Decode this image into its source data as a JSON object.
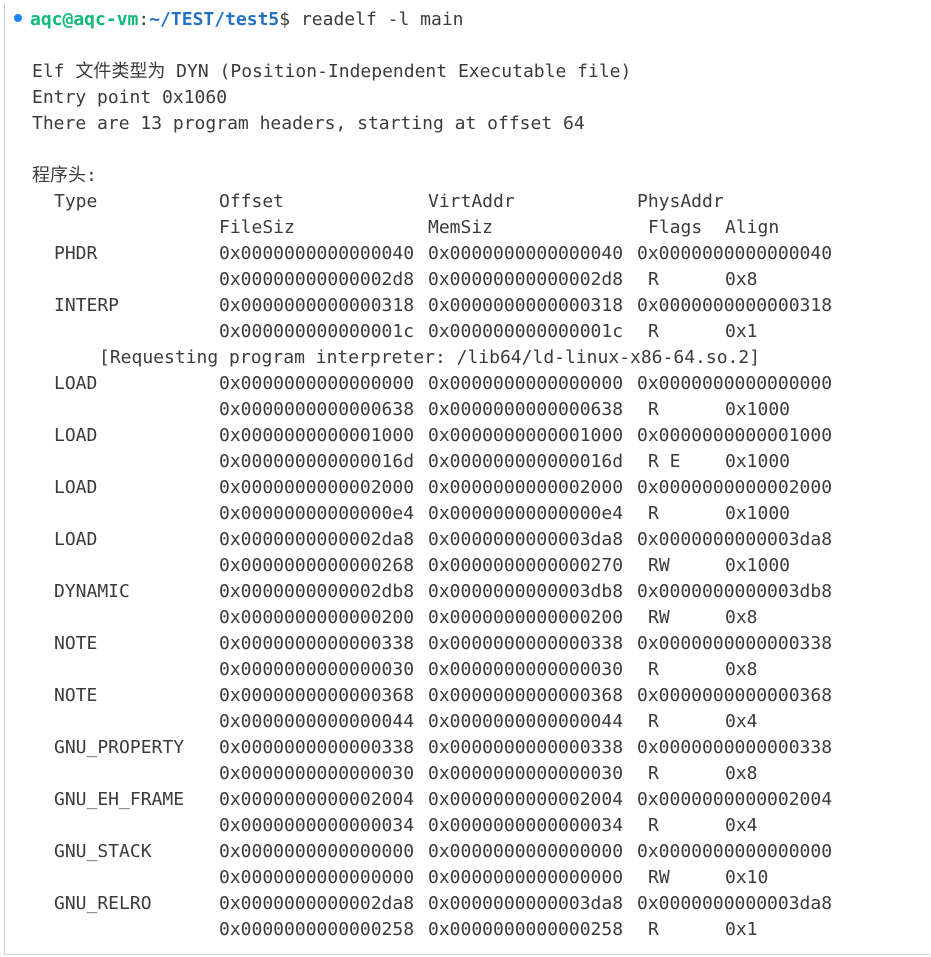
{
  "prompt": {
    "user_host": "aqc@aqc-vm",
    "colon": ":",
    "path": "~/TEST/test5",
    "dollar": "$",
    "command": " readelf -l main"
  },
  "info": {
    "elf_type": "Elf 文件类型为 DYN (Position-Independent Executable file)",
    "entry_point": "Entry point 0x1060",
    "header_count": "There are 13 program headers, starting at offset 64"
  },
  "section_title": "程序头:",
  "columns": {
    "type": "Type",
    "offset": "Offset",
    "virtaddr": "VirtAddr",
    "physaddr": "PhysAddr",
    "filesiz": "FileSiz",
    "memsiz": "MemSiz",
    "flags": "Flags",
    "align": "Align"
  },
  "interp_note": "[Requesting program interpreter: /lib64/ld-linux-x86-64.so.2]",
  "headers": [
    {
      "type": "PHDR",
      "offset": "0x0000000000000040",
      "virtaddr": "0x0000000000000040",
      "physaddr": "0x0000000000000040",
      "filesiz": "0x00000000000002d8",
      "memsiz": "0x00000000000002d8",
      "flags": "R",
      "align": "0x8"
    },
    {
      "type": "INTERP",
      "offset": "0x0000000000000318",
      "virtaddr": "0x0000000000000318",
      "physaddr": "0x0000000000000318",
      "filesiz": "0x000000000000001c",
      "memsiz": "0x000000000000001c",
      "flags": "R",
      "align": "0x1"
    },
    {
      "type": "LOAD",
      "offset": "0x0000000000000000",
      "virtaddr": "0x0000000000000000",
      "physaddr": "0x0000000000000000",
      "filesiz": "0x0000000000000638",
      "memsiz": "0x0000000000000638",
      "flags": "R",
      "align": "0x1000"
    },
    {
      "type": "LOAD",
      "offset": "0x0000000000001000",
      "virtaddr": "0x0000000000001000",
      "physaddr": "0x0000000000001000",
      "filesiz": "0x000000000000016d",
      "memsiz": "0x000000000000016d",
      "flags": "R E",
      "align": "0x1000"
    },
    {
      "type": "LOAD",
      "offset": "0x0000000000002000",
      "virtaddr": "0x0000000000002000",
      "physaddr": "0x0000000000002000",
      "filesiz": "0x00000000000000e4",
      "memsiz": "0x00000000000000e4",
      "flags": "R",
      "align": "0x1000"
    },
    {
      "type": "LOAD",
      "offset": "0x0000000000002da8",
      "virtaddr": "0x0000000000003da8",
      "physaddr": "0x0000000000003da8",
      "filesiz": "0x0000000000000268",
      "memsiz": "0x0000000000000270",
      "flags": "RW",
      "align": "0x1000"
    },
    {
      "type": "DYNAMIC",
      "offset": "0x0000000000002db8",
      "virtaddr": "0x0000000000003db8",
      "physaddr": "0x0000000000003db8",
      "filesiz": "0x0000000000000200",
      "memsiz": "0x0000000000000200",
      "flags": "RW",
      "align": "0x8"
    },
    {
      "type": "NOTE",
      "offset": "0x0000000000000338",
      "virtaddr": "0x0000000000000338",
      "physaddr": "0x0000000000000338",
      "filesiz": "0x0000000000000030",
      "memsiz": "0x0000000000000030",
      "flags": "R",
      "align": "0x8"
    },
    {
      "type": "NOTE",
      "offset": "0x0000000000000368",
      "virtaddr": "0x0000000000000368",
      "physaddr": "0x0000000000000368",
      "filesiz": "0x0000000000000044",
      "memsiz": "0x0000000000000044",
      "flags": "R",
      "align": "0x4"
    },
    {
      "type": "GNU_PROPERTY",
      "offset": "0x0000000000000338",
      "virtaddr": "0x0000000000000338",
      "physaddr": "0x0000000000000338",
      "filesiz": "0x0000000000000030",
      "memsiz": "0x0000000000000030",
      "flags": "R",
      "align": "0x8"
    },
    {
      "type": "GNU_EH_FRAME",
      "offset": "0x0000000000002004",
      "virtaddr": "0x0000000000002004",
      "physaddr": "0x0000000000002004",
      "filesiz": "0x0000000000000034",
      "memsiz": "0x0000000000000034",
      "flags": "R",
      "align": "0x4"
    },
    {
      "type": "GNU_STACK",
      "offset": "0x0000000000000000",
      "virtaddr": "0x0000000000000000",
      "physaddr": "0x0000000000000000",
      "filesiz": "0x0000000000000000",
      "memsiz": "0x0000000000000000",
      "flags": "RW",
      "align": "0x10"
    },
    {
      "type": "GNU_RELRO",
      "offset": "0x0000000000002da8",
      "virtaddr": "0x0000000000003da8",
      "physaddr": "0x0000000000003da8",
      "filesiz": "0x0000000000000258",
      "memsiz": "0x0000000000000258",
      "flags": "R",
      "align": "0x1"
    }
  ],
  "colors": {
    "prompt_user": "#0dbc79",
    "prompt_path": "#2472c8",
    "status_dot": "#1a85ff",
    "text": "#3b3b3b",
    "background": "#ffffff"
  }
}
